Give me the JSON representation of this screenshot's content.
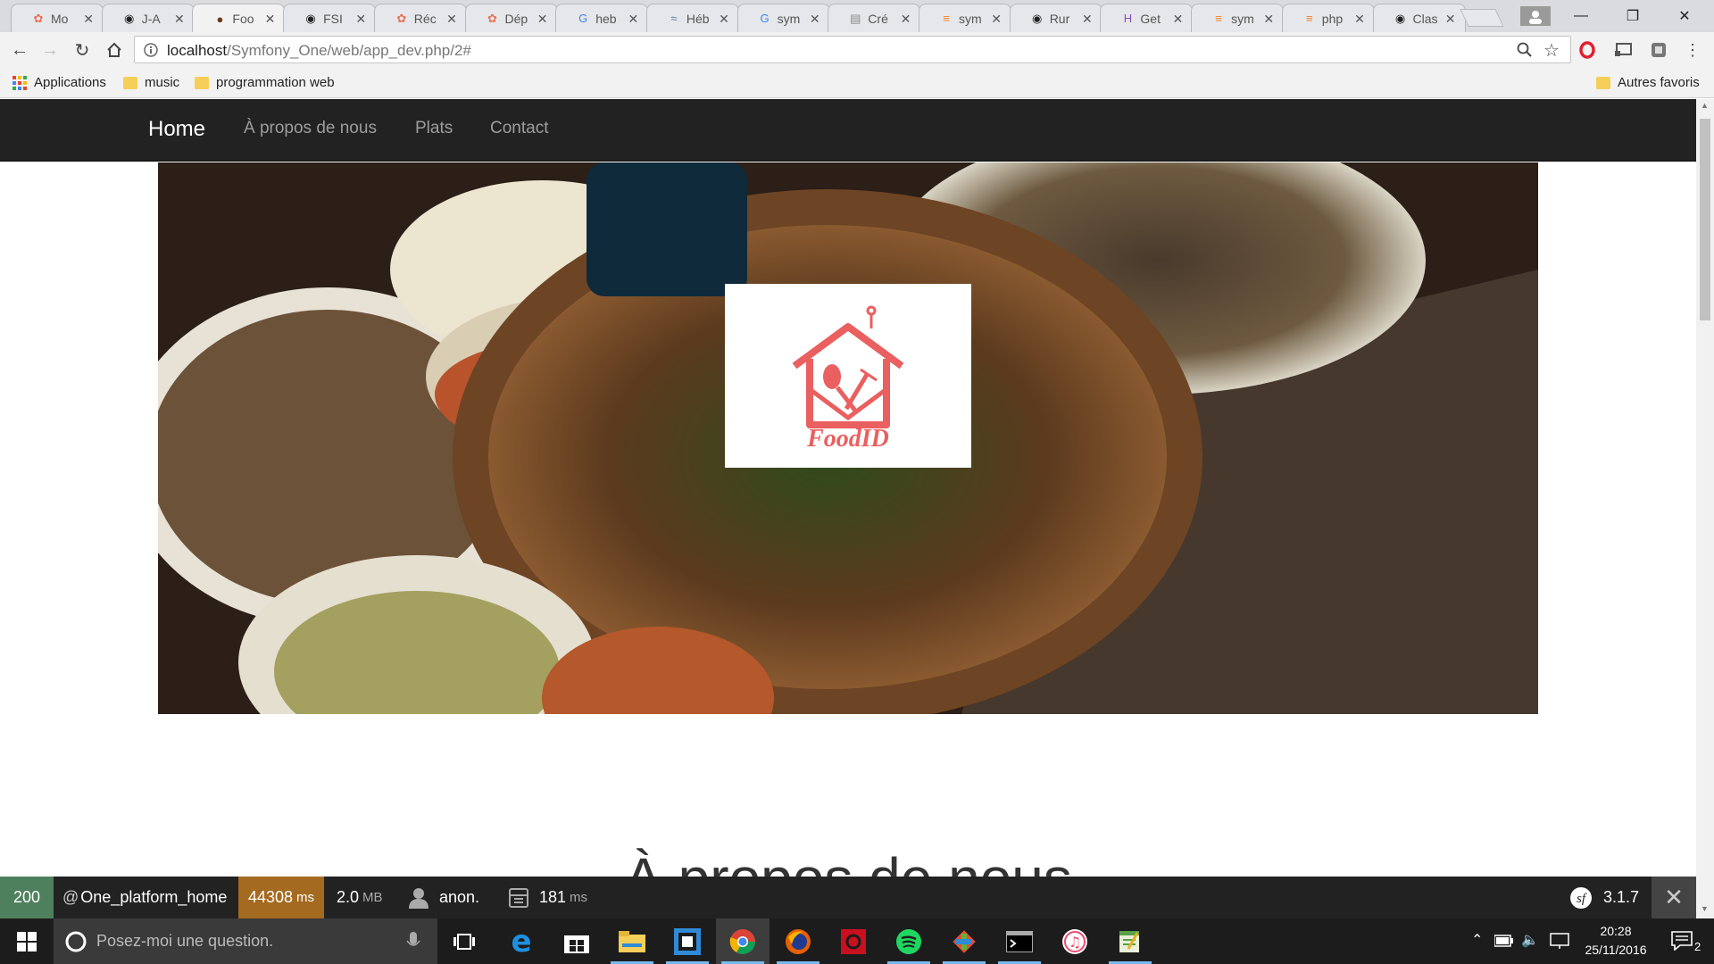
{
  "browser": {
    "tabs": [
      {
        "title": "Mo",
        "icon": "recipe-icon",
        "active": false
      },
      {
        "title": "J-A",
        "icon": "github-icon",
        "active": false
      },
      {
        "title": "Foo",
        "icon": "food-icon",
        "active": true
      },
      {
        "title": "FSI",
        "icon": "github-icon",
        "active": false
      },
      {
        "title": "Réc",
        "icon": "recipe-icon",
        "active": false
      },
      {
        "title": "Dép",
        "icon": "recipe-icon",
        "active": false
      },
      {
        "title": "heb",
        "icon": "google-icon",
        "active": false
      },
      {
        "title": "Héb",
        "icon": "host-icon",
        "active": false
      },
      {
        "title": "sym",
        "icon": "google-icon",
        "active": false
      },
      {
        "title": "Cré",
        "icon": "doc-icon",
        "active": false
      },
      {
        "title": "sym",
        "icon": "stack-icon",
        "active": false
      },
      {
        "title": "Rur",
        "icon": "github-icon",
        "active": false
      },
      {
        "title": "Get",
        "icon": "h-icon",
        "active": false
      },
      {
        "title": "sym",
        "icon": "stack-icon",
        "active": false
      },
      {
        "title": "php",
        "icon": "stack-icon",
        "active": false
      },
      {
        "title": "Clas",
        "icon": "github-icon",
        "active": false
      }
    ],
    "url_host": "localhost",
    "url_path": "/Symfony_One/web/app_dev.php/2#",
    "bookmarks": [
      "Applications",
      "music",
      "programmation web"
    ],
    "other_bookmarks": "Autres favoris"
  },
  "site": {
    "nav": {
      "brand": "Home",
      "links": [
        "À propos de nous",
        "Plats",
        "Contact"
      ]
    },
    "logo_text": "FoodID",
    "section_title": "À propos de nous"
  },
  "debug_toolbar": {
    "status": "200",
    "route": "One_platform_home",
    "time": "44308",
    "time_unit": "ms",
    "memory": "2.0",
    "memory_unit": "MB",
    "user": "anon.",
    "db_time": "181",
    "db_unit": "ms",
    "version": "3.1.7",
    "colors": {
      "status_bg": "#4f805d",
      "time_bg": "#a46a1f"
    }
  },
  "taskbar": {
    "search_placeholder": "Posez-moi une question.",
    "time": "20:28",
    "date": "25/11/2016",
    "notifications": "2"
  }
}
